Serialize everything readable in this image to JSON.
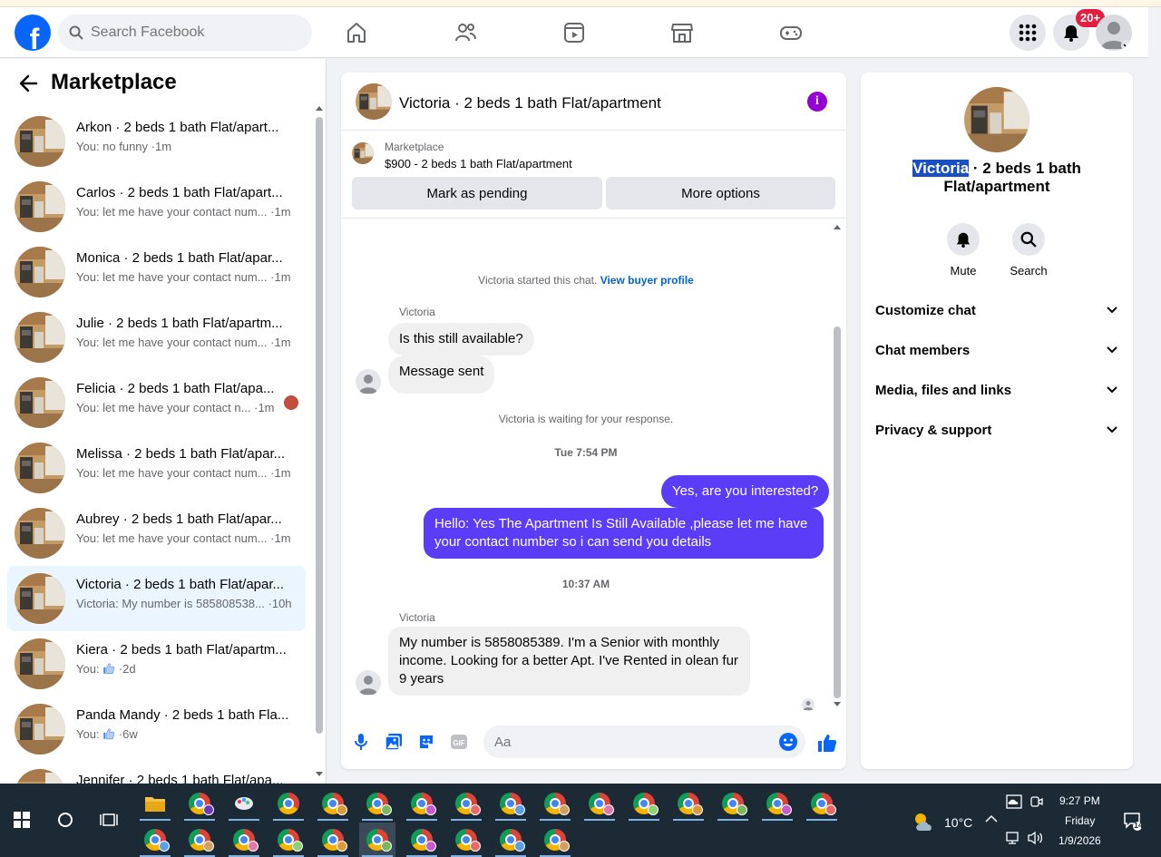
{
  "topbar": {
    "logo": "f",
    "search_placeholder": "Search Facebook",
    "notification_badge": "20+"
  },
  "left": {
    "title": "Marketplace",
    "conversations": [
      {
        "title": "Arkon · 2 beds 1 bath Flat/apart...",
        "snippet": "You: no funny",
        "time": "1m"
      },
      {
        "title": "Carlos · 2 beds 1 bath Flat/apart...",
        "snippet": "You: let me have your contact num...",
        "time": "1m"
      },
      {
        "title": "Monica · 2 beds 1 bath Flat/apar...",
        "snippet": "You: let me have your contact num...",
        "time": "1m"
      },
      {
        "title": "Julie · 2 beds 1 bath Flat/apartm...",
        "snippet": "You: let me have your contact num...",
        "time": "1m"
      },
      {
        "title": "Felicia · 2 beds 1 bath Flat/apa...",
        "snippet": "You: let me have your contact n...",
        "time": "1m"
      },
      {
        "title": "Melissa · 2 beds 1 bath Flat/apar...",
        "snippet": "You: let me have your contact num...",
        "time": "1m"
      },
      {
        "title": "Aubrey · 2 beds 1 bath Flat/apar...",
        "snippet": "You: let me have your contact num...",
        "time": "1m"
      },
      {
        "title": "Victoria · 2 beds 1 bath Flat/apar...",
        "snippet": "Victoria: My number is 585808538...",
        "time": "10h"
      },
      {
        "title": "Kiera · 2 beds 1 bath Flat/apartm...",
        "snippet": "You: ",
        "time": "2d"
      },
      {
        "title": "Panda Mandy · 2 beds 1 bath Fla...",
        "snippet": "You: ",
        "time": "6w"
      },
      {
        "title": "Jennifer · 2 beds 1 bath Flat/apa...",
        "snippet": "",
        "time": ""
      }
    ]
  },
  "chat": {
    "title": "Victoria · 2 beds 1 bath Flat/apartment",
    "marketplace_label": "Marketplace",
    "listing": "$900 - 2 beds 1 bath Flat/apartment",
    "mark_pending": "Mark as pending",
    "more_options": "More options",
    "started": "Victoria started this chat.",
    "view_buyer": "View buyer profile",
    "sender_name": "Victoria",
    "msg1": "Is this still available?",
    "msg2": "Message sent",
    "waiting": "Victoria is waiting for your response.",
    "time1": "Tue 7:54 PM",
    "out1": "Yes, are you interested?",
    "out2": "Hello: Yes The Apartment Is Still Available ,please let me have your contact number so i can send you details",
    "time2": "10:37 AM",
    "msg3": "My number is 5858085389. I'm a Senior with monthly income. Looking for a better Apt. I've Rented in olean fur 9 years",
    "input_placeholder": "Aa"
  },
  "details": {
    "name_highlight": "Victoria",
    "name_rest_line1": " · 2 beds 1 bath",
    "name_rest_line2": "Flat/apartment",
    "mute": "Mute",
    "search": "Search",
    "sections": [
      "Customize chat",
      "Chat members",
      "Media, files and links",
      "Privacy & support"
    ]
  },
  "taskbar": {
    "temperature": "10°C",
    "time": "9:27 PM",
    "day": "Friday",
    "date": "1/9/2026",
    "notif_count": "14"
  },
  "colors": {
    "brand": "#0866ff",
    "outgoing": "#5b3cf7",
    "info": "#9400d3",
    "badge": "#e41e3f"
  }
}
